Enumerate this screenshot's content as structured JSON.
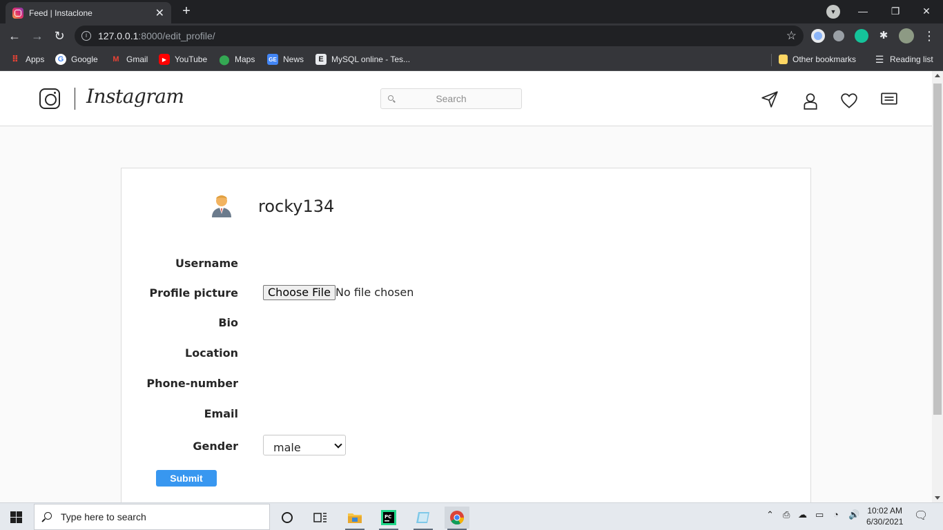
{
  "browser": {
    "tab_title": "Feed | Instaclone",
    "url_host": "127.0.0.1",
    "url_rest": ":8000/edit_profile/",
    "bookmarks": [
      {
        "label": "Apps",
        "icon": "apps-grid-icon"
      },
      {
        "label": "Google",
        "icon": "google-icon"
      },
      {
        "label": "Gmail",
        "icon": "gmail-icon"
      },
      {
        "label": "YouTube",
        "icon": "youtube-icon"
      },
      {
        "label": "Maps",
        "icon": "maps-icon"
      },
      {
        "label": "News",
        "icon": "news-icon"
      },
      {
        "label": "MySQL online - Tes...",
        "icon": "e-icon"
      }
    ],
    "other_bookmarks": "Other bookmarks",
    "reading_list": "Reading list"
  },
  "header": {
    "logo_text": "Instagram",
    "search_placeholder": "Search",
    "icons": [
      "send-icon",
      "profile-icon",
      "heart-icon",
      "menu-icon"
    ]
  },
  "profile": {
    "username": "rocky134",
    "avatar_icon": "man-emoji-icon"
  },
  "form": {
    "labels": {
      "username": "Username",
      "profile_picture": "Profile picture",
      "bio": "Bio",
      "location": "Location",
      "phone": "Phone-number",
      "email": "Email",
      "gender": "Gender"
    },
    "file_button": "Choose File",
    "file_status": "No file chosen",
    "gender_value": "male",
    "submit_label": "Submit"
  },
  "taskbar": {
    "search_placeholder": "Type here to search",
    "time": "10:02 AM",
    "date": "6/30/2021"
  },
  "colors": {
    "accent": "#3897f0",
    "border": "#dbdbdb",
    "text": "#262626"
  }
}
